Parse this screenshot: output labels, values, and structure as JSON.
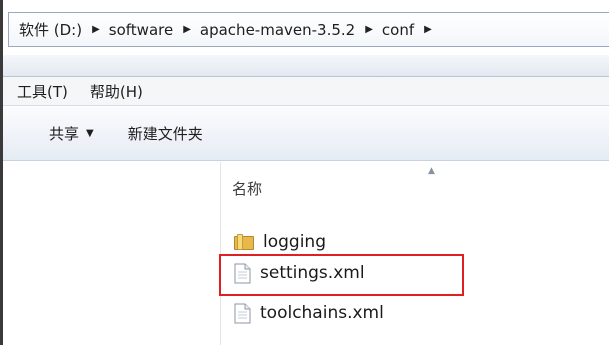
{
  "address_bar": {
    "crumbs": [
      "软件 (D:)",
      "software",
      "apache-maven-3.5.2",
      "conf"
    ],
    "separator": "▶"
  },
  "menu_bar": {
    "items": [
      "工具(T)",
      "帮助(H)"
    ]
  },
  "command_bar": {
    "share_label": "共享",
    "share_caret": "▼",
    "new_folder_label": "新建文件夹"
  },
  "file_list": {
    "column_header": "名称",
    "sort_indicator": "▲",
    "items": [
      {
        "name": "logging",
        "icon": "folder-icon"
      },
      {
        "name": "settings.xml",
        "icon": "xml-file-icon"
      },
      {
        "name": "toolchains.xml",
        "icon": "xml-file-icon"
      }
    ]
  },
  "colors": {
    "highlight": "#e02020",
    "folder": "#e7b94a"
  }
}
